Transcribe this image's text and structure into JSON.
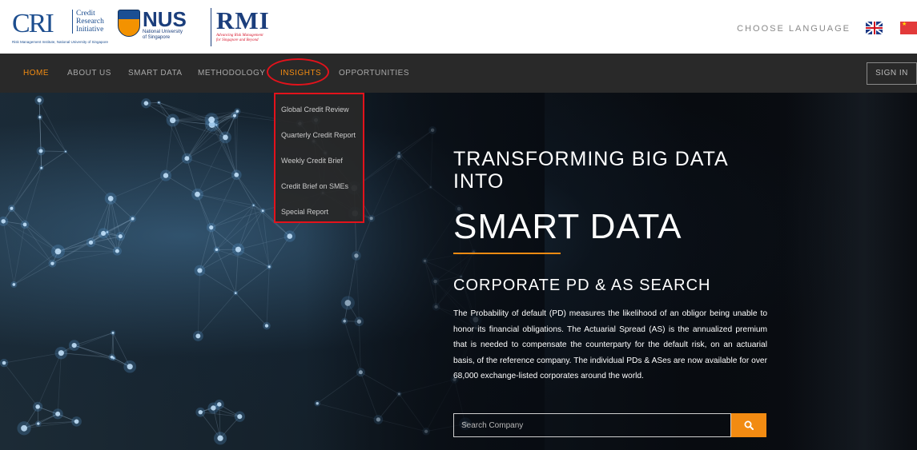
{
  "header": {
    "cri_logo": {
      "mark": "CRI",
      "lines": [
        "Credit",
        "Research",
        "Initiative"
      ],
      "sub": "Risk Management Institute, National University of Singapore"
    },
    "nus_logo": {
      "mark": "NUS",
      "sub": [
        "National University",
        "of Singapore"
      ]
    },
    "rmi_logo": {
      "mark": "RMI",
      "sub": [
        "Advancing Risk Management",
        "for Singapore and Beyond"
      ]
    },
    "language_label": "CHOOSE LANGUAGE",
    "flags": [
      "uk-flag-icon",
      "china-flag-icon"
    ]
  },
  "nav": {
    "items": [
      {
        "label": "HOME",
        "active": true
      },
      {
        "label": "ABOUT US",
        "active": false
      },
      {
        "label": "SMART DATA",
        "active": false
      },
      {
        "label": "METHODOLOGY",
        "active": false
      },
      {
        "label": "INSIGHTS",
        "active": true
      },
      {
        "label": "OPPORTUNITIES",
        "active": false
      }
    ],
    "sign_in": "SIGN IN"
  },
  "dropdown": {
    "items": [
      "Global Credit Review",
      "Quarterly Credit Report",
      "Weekly Credit Brief",
      "Credit Brief on SMEs",
      "Special Report"
    ]
  },
  "hero": {
    "title_line1": "TRANSFORMING BIG DATA INTO",
    "title_line2": "SMART DATA",
    "subtitle": "CORPORATE PD & AS SEARCH",
    "description": "The Probability of default (PD) measures the likelihood of an obligor being unable to honor its financial obligations. The Actuarial Spread (AS) is the annualized premium that is needed to compensate the counterparty for the default risk, on an actuarial basis, of the reference company. The individual PDs & ASes are now available for over 68,000 exchange-listed corporates around the world.",
    "search_placeholder": "Search Company",
    "search_icon": "search-icon"
  },
  "colors": {
    "accent": "#f28b12",
    "nav_bg": "#292929",
    "highlight": "#e3121b",
    "brand_blue": "#1b3e7c"
  }
}
